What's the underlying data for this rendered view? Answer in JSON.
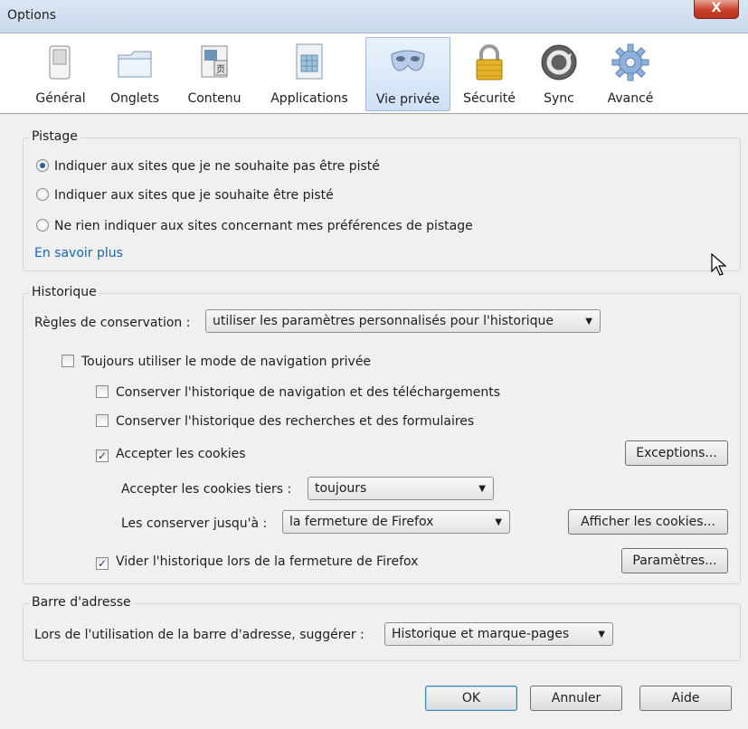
{
  "window": {
    "title": "Options",
    "close_label": "X"
  },
  "toolbar": {
    "items": [
      {
        "label": "Général",
        "icon": "general-switch-icon"
      },
      {
        "label": "Onglets",
        "icon": "tabs-icon"
      },
      {
        "label": "Contenu",
        "icon": "content-icon"
      },
      {
        "label": "Applications",
        "icon": "applications-icon"
      },
      {
        "label": "Vie privée",
        "icon": "privacy-mask-icon",
        "selected": true
      },
      {
        "label": "Sécurité",
        "icon": "padlock-icon"
      },
      {
        "label": "Sync",
        "icon": "sync-icon"
      },
      {
        "label": "Avancé",
        "icon": "gear-icon"
      }
    ]
  },
  "tracking": {
    "title": "Pistage",
    "options": [
      "Indiquer aux sites que je ne souhaite pas être pisté",
      "Indiquer aux sites que je souhaite être pisté",
      "Ne rien indiquer aux sites concernant mes préférences de pistage"
    ],
    "selected_index": 0,
    "learn_more": "En savoir plus"
  },
  "history": {
    "title": "Historique",
    "rules_label": "Règles de conservation :",
    "rules_value": "utiliser les paramètres personnalisés pour l'historique",
    "private_mode": "Toujours utiliser le mode de navigation privée",
    "keep_browsing": "Conserver l'historique de navigation et des téléchargements",
    "keep_search": "Conserver l'historique des recherches et des formulaires",
    "accept_cookies": "Accepter les cookies",
    "exceptions_button": "Exceptions...",
    "third_party_label": "Accepter les cookies tiers :",
    "third_party_value": "toujours",
    "keep_until_label": "Les conserver jusqu'à :",
    "keep_until_value": "la fermeture de Firefox",
    "show_cookies_button": "Afficher les cookies...",
    "clear_history": "Vider l'historique lors de la fermeture de Firefox",
    "settings_button": "Paramètres..."
  },
  "address_bar": {
    "title": "Barre d'adresse",
    "suggest_label": "Lors de l'utilisation de la barre d'adresse, suggérer :",
    "suggest_value": "Historique et marque-pages"
  },
  "buttons": {
    "ok": "OK",
    "cancel": "Annuler",
    "help": "Aide"
  }
}
